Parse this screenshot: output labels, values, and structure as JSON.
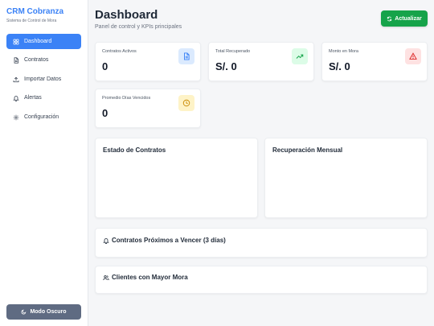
{
  "sidebar": {
    "brand": "CRM Cobranza",
    "brand_subtitle": "Sistema de Control de Mora",
    "items": [
      {
        "label": "Dashboard",
        "icon": "dashboard-icon"
      },
      {
        "label": "Contratos",
        "icon": "document-icon"
      },
      {
        "label": "Importar Datos",
        "icon": "upload-icon"
      },
      {
        "label": "Alertas",
        "icon": "bell-icon"
      },
      {
        "label": "Configuración",
        "icon": "gear-icon"
      }
    ],
    "dark_mode_label": "Modo Oscuro"
  },
  "header": {
    "title": "Dashboard",
    "subtitle": "Panel de control y KPIs principales",
    "refresh_label": "Actualizar"
  },
  "stats": [
    {
      "label": "Contratos Activos",
      "value": "0",
      "icon": "document-icon",
      "color": "#3b82f6",
      "bg": "#dbeafe"
    },
    {
      "label": "Total Recuperado",
      "value": "S/. 0",
      "icon": "trending-up-icon",
      "color": "#16a34a",
      "bg": "#dcfce7"
    },
    {
      "label": "Monto en Mora",
      "value": "S/. 0",
      "icon": "warning-icon",
      "color": "#dc2626",
      "bg": "#fee2e2"
    },
    {
      "label": "Promedio Días Vencidos",
      "value": "0",
      "icon": "clock-icon",
      "color": "#ca8a04",
      "bg": "#fef3c7"
    }
  ],
  "panels": {
    "contract_status": "Estado de Contratos",
    "monthly_recovery": "Recuperación Mensual",
    "expiring": "Contratos Próximos a Vencer (3 días)",
    "top_overdue": "Clientes con Mayor Mora"
  },
  "colors": {
    "accent": "#3b82f6",
    "success": "#16a34a",
    "dark_button": "#5f6b82"
  }
}
